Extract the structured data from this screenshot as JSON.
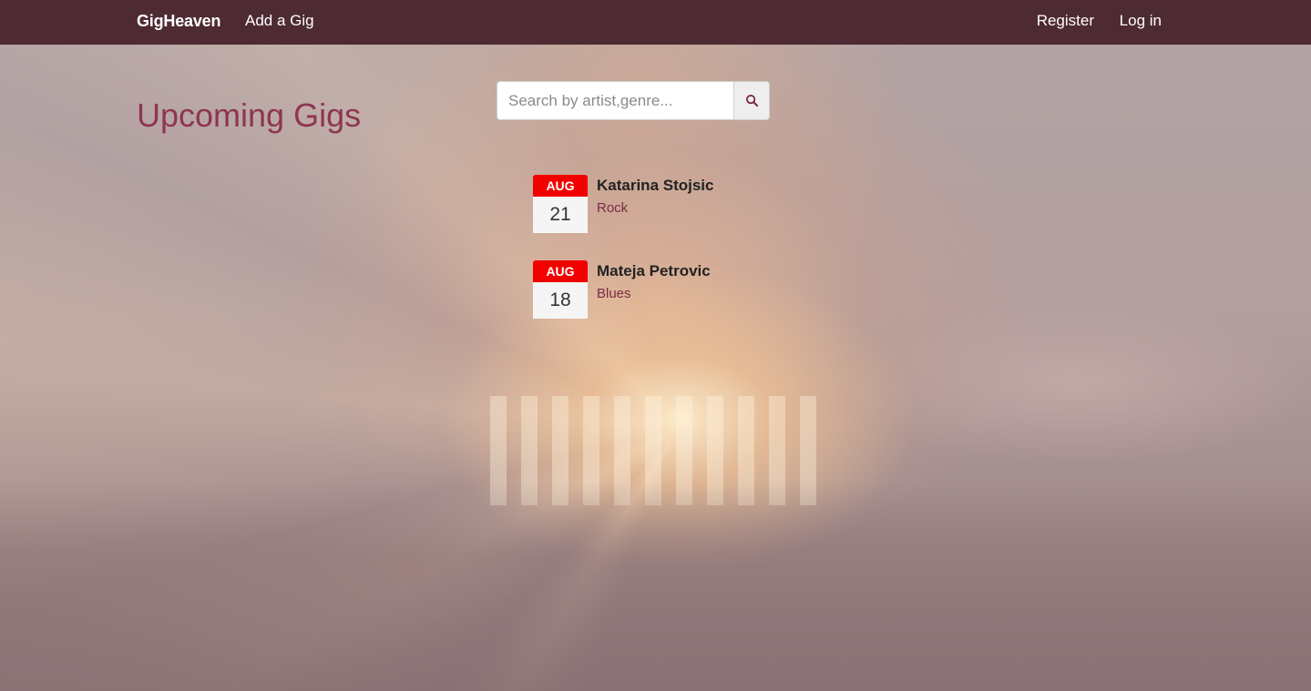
{
  "navbar": {
    "brand": "GigHeaven",
    "add_gig": "Add a Gig",
    "register": "Register",
    "login": "Log in"
  },
  "page": {
    "title": "Upcoming Gigs"
  },
  "search": {
    "placeholder": "Search by artist,genre...",
    "value": "",
    "icon": "search-icon"
  },
  "gigs": [
    {
      "month": "AUG",
      "day": "21",
      "artist": "Katarina Stojsic",
      "genre": "Rock"
    },
    {
      "month": "AUG",
      "day": "18",
      "artist": "Mateja Petrovic",
      "genre": "Blues"
    }
  ],
  "colors": {
    "navbar": "#4e2a33",
    "title": "#8e3553",
    "calendar_month": "#f20000",
    "genre": "#7a2b45"
  }
}
